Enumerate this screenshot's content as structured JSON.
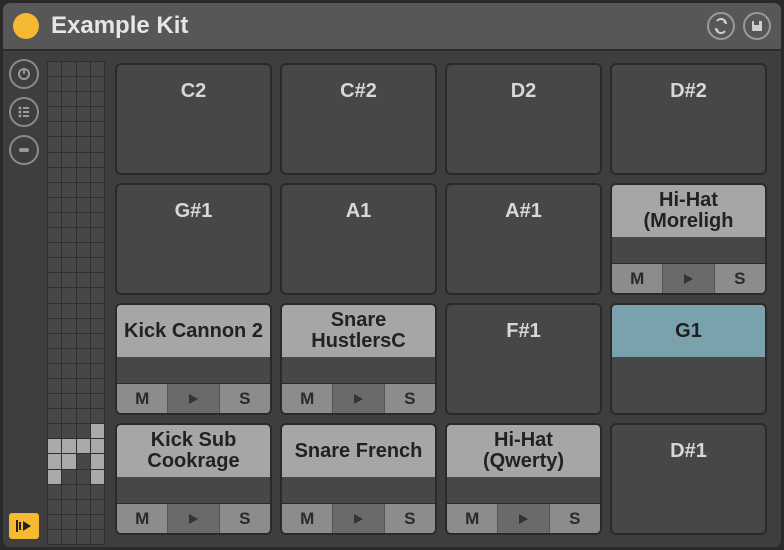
{
  "title": "Example Kit",
  "colors": {
    "accent": "#f7b931",
    "selected": "#7aa2ad"
  },
  "pads": [
    {
      "slot": 0,
      "label": "C2",
      "loaded": false,
      "selected": false
    },
    {
      "slot": 1,
      "label": "C#2",
      "loaded": false,
      "selected": false
    },
    {
      "slot": 2,
      "label": "D2",
      "loaded": false,
      "selected": false
    },
    {
      "slot": 3,
      "label": "D#2",
      "loaded": false,
      "selected": false
    },
    {
      "slot": 4,
      "label": "G#1",
      "loaded": false,
      "selected": false
    },
    {
      "slot": 5,
      "label": "A1",
      "loaded": false,
      "selected": false
    },
    {
      "slot": 6,
      "label": "A#1",
      "loaded": false,
      "selected": false
    },
    {
      "slot": 7,
      "label": "Hi-Hat (Moreligh",
      "loaded": true,
      "selected": false
    },
    {
      "slot": 8,
      "label": "Kick Cannon 2",
      "loaded": true,
      "selected": false
    },
    {
      "slot": 9,
      "label": "Snare HustlersC",
      "loaded": true,
      "selected": false
    },
    {
      "slot": 10,
      "label": "F#1",
      "loaded": false,
      "selected": false
    },
    {
      "slot": 11,
      "label": "G1",
      "loaded": false,
      "selected": true
    },
    {
      "slot": 12,
      "label": "Kick Sub Cookrage",
      "loaded": true,
      "selected": false
    },
    {
      "slot": 13,
      "label": "Snare French",
      "loaded": true,
      "selected": false
    },
    {
      "slot": 14,
      "label": "Hi-Hat (Qwerty)",
      "loaded": true,
      "selected": false
    },
    {
      "slot": 15,
      "label": "D#1",
      "loaded": false,
      "selected": false
    }
  ],
  "pad_controls": {
    "mute": "M",
    "solo": "S"
  },
  "overview_filled": [
    [
      24,
      3
    ],
    [
      25,
      0
    ],
    [
      25,
      1
    ],
    [
      25,
      2
    ],
    [
      25,
      3
    ],
    [
      26,
      0
    ],
    [
      26,
      1
    ],
    [
      26,
      3
    ],
    [
      27,
      0
    ],
    [
      27,
      3
    ]
  ],
  "overview_rows": 32,
  "overview_cols": 4
}
